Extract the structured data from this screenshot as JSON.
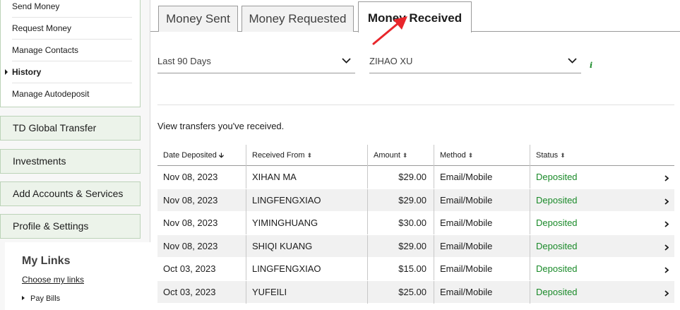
{
  "sidebar": {
    "submenu": [
      {
        "label": "Send Money"
      },
      {
        "label": "Request Money"
      },
      {
        "label": "Manage Contacts"
      },
      {
        "label": "History"
      },
      {
        "label": "Manage Autodeposit"
      }
    ],
    "sections": [
      {
        "label": "TD Global Transfer"
      },
      {
        "label": "Investments"
      },
      {
        "label": "Add Accounts & Services"
      },
      {
        "label": "Profile & Settings"
      }
    ],
    "my_links": {
      "title": "My Links",
      "choose_label": "Choose my links",
      "items": [
        {
          "label": "Pay Bills"
        }
      ]
    }
  },
  "tabs": [
    {
      "label": "Money Sent",
      "active": false
    },
    {
      "label": "Money Requested",
      "active": false
    },
    {
      "label": "Money Received",
      "active": true
    }
  ],
  "filters": {
    "period": "Last 90 Days",
    "recipient": "ZIHAO XU",
    "info_icon": "i"
  },
  "intro_text": "View transfers you've received.",
  "table": {
    "headers": [
      "Date Deposited",
      "Received From",
      "Amount",
      "Method",
      "Status"
    ],
    "sorted_column": "Date Deposited",
    "rows": [
      {
        "date": "Nov 08, 2023",
        "from": "XIHAN MA",
        "amount": "$29.00",
        "method": "Email/Mobile",
        "status": "Deposited"
      },
      {
        "date": "Nov 08, 2023",
        "from": "LINGFENGXIAO",
        "amount": "$29.00",
        "method": "Email/Mobile",
        "status": "Deposited"
      },
      {
        "date": "Nov 08, 2023",
        "from": "YIMINGHUANG",
        "amount": "$30.00",
        "method": "Email/Mobile",
        "status": "Deposited"
      },
      {
        "date": "Nov 08, 2023",
        "from": "SHIQI KUANG",
        "amount": "$29.00",
        "method": "Email/Mobile",
        "status": "Deposited"
      },
      {
        "date": "Oct 03, 2023",
        "from": "LINGFENGXIAO",
        "amount": "$15.00",
        "method": "Email/Mobile",
        "status": "Deposited"
      },
      {
        "date": "Oct 03, 2023",
        "from": "YUFEILI",
        "amount": "$25.00",
        "method": "Email/Mobile",
        "status": "Deposited"
      }
    ]
  },
  "colors": {
    "brand_green": "#1a8a29",
    "nav_bg": "#ecf3ea",
    "annotation_red": "#e8262b"
  }
}
